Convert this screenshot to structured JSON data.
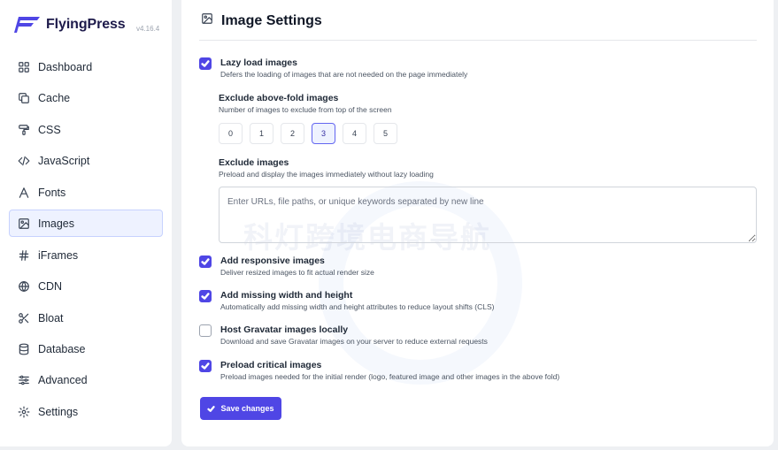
{
  "brand": {
    "name": "FlyingPress",
    "version": "v4.16.4"
  },
  "sidebar": {
    "items": [
      {
        "label": "Dashboard",
        "icon": "grid-icon"
      },
      {
        "label": "Cache",
        "icon": "copy-icon"
      },
      {
        "label": "CSS",
        "icon": "paint-roller-icon"
      },
      {
        "label": "JavaScript",
        "icon": "code-icon"
      },
      {
        "label": "Fonts",
        "icon": "font-icon"
      },
      {
        "label": "Images",
        "icon": "image-icon",
        "active": true
      },
      {
        "label": "iFrames",
        "icon": "hash-icon"
      },
      {
        "label": "CDN",
        "icon": "globe-icon"
      },
      {
        "label": "Bloat",
        "icon": "scissors-icon"
      },
      {
        "label": "Database",
        "icon": "database-icon"
      },
      {
        "label": "Advanced",
        "icon": "sliders-icon"
      },
      {
        "label": "Settings",
        "icon": "gear-icon"
      }
    ]
  },
  "page": {
    "title": "Image Settings",
    "icon": "image-icon"
  },
  "options": {
    "lazy_load": {
      "title": "Lazy load images",
      "desc": "Defers the loading of images that are not needed on the page immediately",
      "checked": true
    },
    "exclude_above_fold": {
      "title": "Exclude above-fold images",
      "desc": "Number of images to exclude from top of the screen",
      "choices": [
        "0",
        "1",
        "2",
        "3",
        "4",
        "5"
      ],
      "selected": "3"
    },
    "exclude_images": {
      "title": "Exclude images",
      "desc": "Preload and display the images immediately without lazy loading",
      "placeholder": "Enter URLs, file paths, or unique keywords separated by new line",
      "value": ""
    },
    "responsive": {
      "title": "Add responsive images",
      "desc": "Deliver resized images to fit actual render size",
      "checked": true
    },
    "dimensions": {
      "title": "Add missing width and height",
      "desc": "Automatically add missing width and height attributes to reduce layout shifts (CLS)",
      "checked": true
    },
    "gravatar": {
      "title": "Host Gravatar images locally",
      "desc": "Download and save Gravatar images on your server to reduce external requests",
      "checked": false
    },
    "preload_critical": {
      "title": "Preload critical images",
      "desc": "Preload images needed for the initial render (logo, featured image and other images in the above fold)",
      "checked": true
    }
  },
  "save_button": {
    "label": "Save changes",
    "icon": "check-icon"
  },
  "watermark": {
    "text": "科灯跨境电商导航"
  },
  "colors": {
    "accent": "#4f46e5",
    "active_bg": "#eef2ff",
    "page_bg": "#eef0f3"
  }
}
